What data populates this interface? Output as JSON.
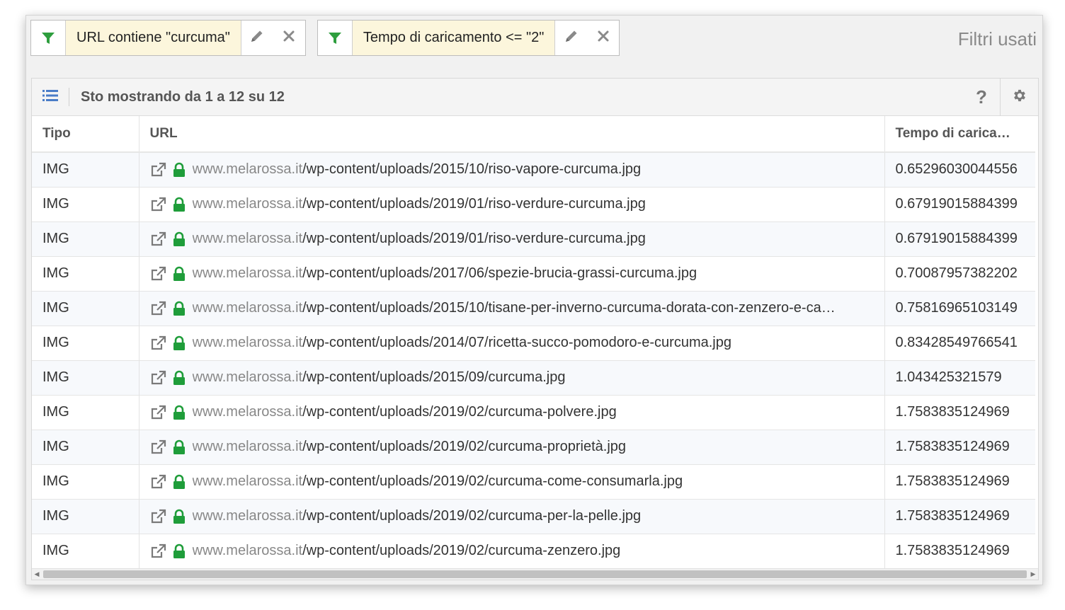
{
  "filters": [
    {
      "label": "URL contiene \"curcuma\""
    },
    {
      "label": "Tempo di caricamento <= \"2\""
    }
  ],
  "filters_used_label": "Filtri usati",
  "toolbar": {
    "summary": "Sto mostrando da 1 a 12 su 12",
    "help": "?"
  },
  "table": {
    "columns": [
      "Tipo",
      "URL",
      "Tempo di carica…"
    ],
    "rows": [
      {
        "tipo": "IMG",
        "domain": "www.melarossa.it",
        "path": "/wp-content/uploads/2015/10/riso-vapore-curcuma.jpg",
        "tempo": "0.65296030044556"
      },
      {
        "tipo": "IMG",
        "domain": "www.melarossa.it",
        "path": "/wp-content/uploads/2019/01/riso-verdure-curcuma.jpg",
        "tempo": "0.67919015884399"
      },
      {
        "tipo": "IMG",
        "domain": "www.melarossa.it",
        "path": "/wp-content/uploads/2019/01/riso-verdure-curcuma.jpg",
        "tempo": "0.67919015884399"
      },
      {
        "tipo": "IMG",
        "domain": "www.melarossa.it",
        "path": "/wp-content/uploads/2017/06/spezie-brucia-grassi-curcuma.jpg",
        "tempo": "0.70087957382202"
      },
      {
        "tipo": "IMG",
        "domain": "www.melarossa.it",
        "path": "/wp-content/uploads/2015/10/tisane-per-inverno-curcuma-dorata-con-zenzero-e-ca…",
        "tempo": "0.75816965103149"
      },
      {
        "tipo": "IMG",
        "domain": "www.melarossa.it",
        "path": "/wp-content/uploads/2014/07/ricetta-succo-pomodoro-e-curcuma.jpg",
        "tempo": "0.83428549766541"
      },
      {
        "tipo": "IMG",
        "domain": "www.melarossa.it",
        "path": "/wp-content/uploads/2015/09/curcuma.jpg",
        "tempo": "1.043425321579"
      },
      {
        "tipo": "IMG",
        "domain": "www.melarossa.it",
        "path": "/wp-content/uploads/2019/02/curcuma-polvere.jpg",
        "tempo": "1.7583835124969"
      },
      {
        "tipo": "IMG",
        "domain": "www.melarossa.it",
        "path": "/wp-content/uploads/2019/02/curcuma-proprietà.jpg",
        "tempo": "1.7583835124969"
      },
      {
        "tipo": "IMG",
        "domain": "www.melarossa.it",
        "path": "/wp-content/uploads/2019/02/curcuma-come-consumarla.jpg",
        "tempo": "1.7583835124969"
      },
      {
        "tipo": "IMG",
        "domain": "www.melarossa.it",
        "path": "/wp-content/uploads/2019/02/curcuma-per-la-pelle.jpg",
        "tempo": "1.7583835124969"
      },
      {
        "tipo": "IMG",
        "domain": "www.melarossa.it",
        "path": "/wp-content/uploads/2019/02/curcuma-zenzero.jpg",
        "tempo": "1.7583835124969"
      }
    ]
  },
  "colors": {
    "filter_icon": "#2e9e3e",
    "lock_icon": "#1f9d3a",
    "list_icon": "#4a7cc7",
    "chip_label_bg": "#fcf6dc"
  }
}
